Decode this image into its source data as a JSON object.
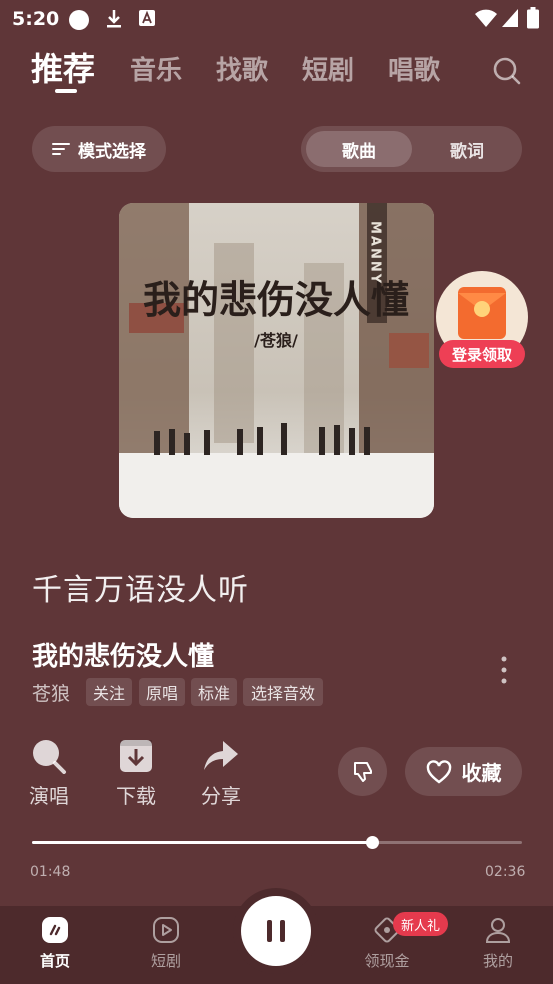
{
  "status_bar": {
    "time": "5:20"
  },
  "tabs": [
    {
      "label": "推荐",
      "active": true
    },
    {
      "label": "音乐"
    },
    {
      "label": "找歌"
    },
    {
      "label": "短剧"
    },
    {
      "label": "唱歌"
    }
  ],
  "mode_button": "模式选择",
  "segment": {
    "song": "歌曲",
    "lyrics": "歌词"
  },
  "album_art": {
    "title_text": "我的悲伤没人懂",
    "artist_text": "/苍狼/",
    "sign_text": "MANNY"
  },
  "promo": {
    "label": "登录领取"
  },
  "current_lyric": "千言万语没人听",
  "song": {
    "title": "我的悲伤没人懂",
    "artist": "苍狼"
  },
  "chips": [
    "关注",
    "原唱",
    "标准",
    "选择音效"
  ],
  "actions": {
    "sing": "演唱",
    "download": "下载",
    "share": "分享",
    "favorite": "收藏"
  },
  "progress": {
    "current": "01:48",
    "total": "02:36",
    "fraction": 0.693
  },
  "bottom_nav": {
    "home": "首页",
    "short_drama": "短剧",
    "rewards": "领现金",
    "rewards_badge": "新人礼",
    "me": "我的"
  },
  "colors": {
    "background": "#5f3638",
    "nav_background": "#4d2a2c",
    "badge": "#e53a4d"
  }
}
